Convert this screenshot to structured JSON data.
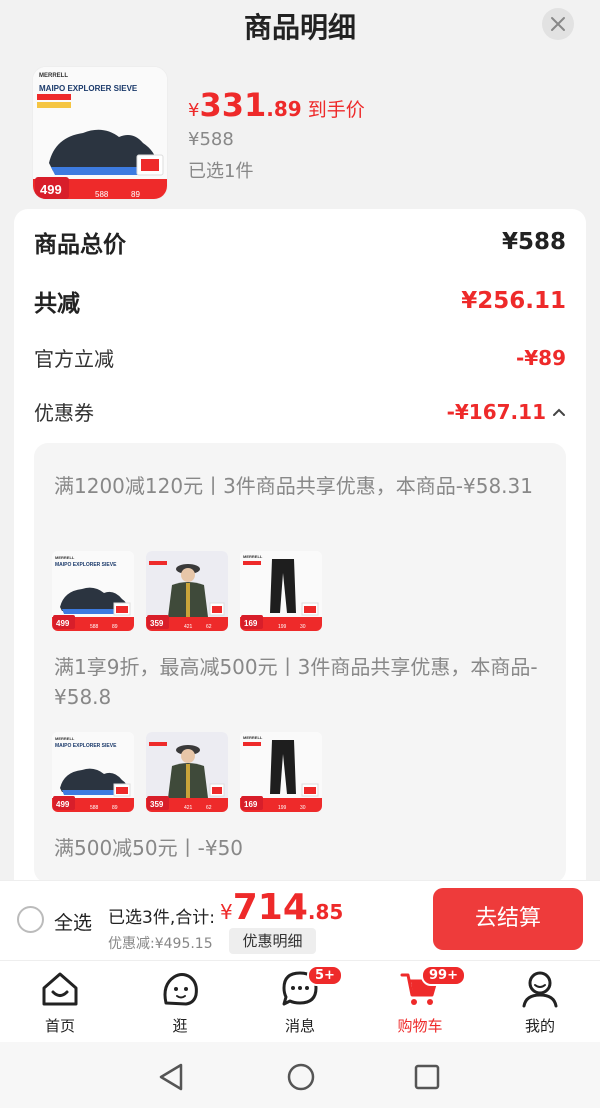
{
  "header": {
    "title": "商品明细"
  },
  "product": {
    "price_symbol": "¥",
    "price_int": "331",
    "price_dec": ".89",
    "price_tag": "到手价",
    "original_price": "¥588",
    "selected_count": "已选1件",
    "thumb": {
      "brand": "MERRELL",
      "model": "MAIPO EXPLORER SIEVE",
      "badge_price": "499",
      "sub_price_1": "588",
      "sub_price_2": "89"
    }
  },
  "breakdown": {
    "total_label": "商品总价",
    "total_value": "¥588",
    "reduce_label": "共减",
    "reduce_value": "¥256.11",
    "official_label": "官方立减",
    "official_value": "-¥89",
    "coupon_label": "优惠券",
    "coupon_value": "-¥167.11"
  },
  "coupons": [
    {
      "text": "满1200减120元丨3件商品共享优惠，本商品-¥58.31",
      "items": [
        {
          "kind": "shoe",
          "badge": "499",
          "price": "588",
          "sub": "89"
        },
        {
          "kind": "jacket",
          "badge": "359",
          "price": "421",
          "sub": "62"
        },
        {
          "kind": "pants",
          "badge": "169",
          "price": "199",
          "sub": "30"
        }
      ]
    },
    {
      "text": "满1享9折，最高减500元丨3件商品共享优惠，本商品-¥58.8",
      "items": [
        {
          "kind": "shoe",
          "badge": "499",
          "price": "588",
          "sub": "89"
        },
        {
          "kind": "jacket",
          "badge": "359",
          "price": "421",
          "sub": "62"
        },
        {
          "kind": "pants",
          "badge": "169",
          "price": "199",
          "sub": "30"
        }
      ]
    },
    {
      "text": "满500减50元丨-¥50"
    }
  ],
  "bottom_bar": {
    "select_all": "全选",
    "selected_summary": "已选3件,合计:",
    "total_symbol": "¥",
    "total_int": "714",
    "total_dec": ".85",
    "discount": "优惠减:¥495.15",
    "detail_button": "优惠明细",
    "checkout": "去结算"
  },
  "tabs": [
    {
      "label": "首页",
      "icon": "home-icon"
    },
    {
      "label": "逛",
      "icon": "browse-icon"
    },
    {
      "label": "消息",
      "icon": "message-icon",
      "badge": "5+"
    },
    {
      "label": "购物车",
      "icon": "cart-icon",
      "badge": "99+",
      "active": true
    },
    {
      "label": "我的",
      "icon": "profile-icon"
    }
  ],
  "colors": {
    "accent": "#ee2a2a",
    "checkout": "#ee3b3b"
  }
}
